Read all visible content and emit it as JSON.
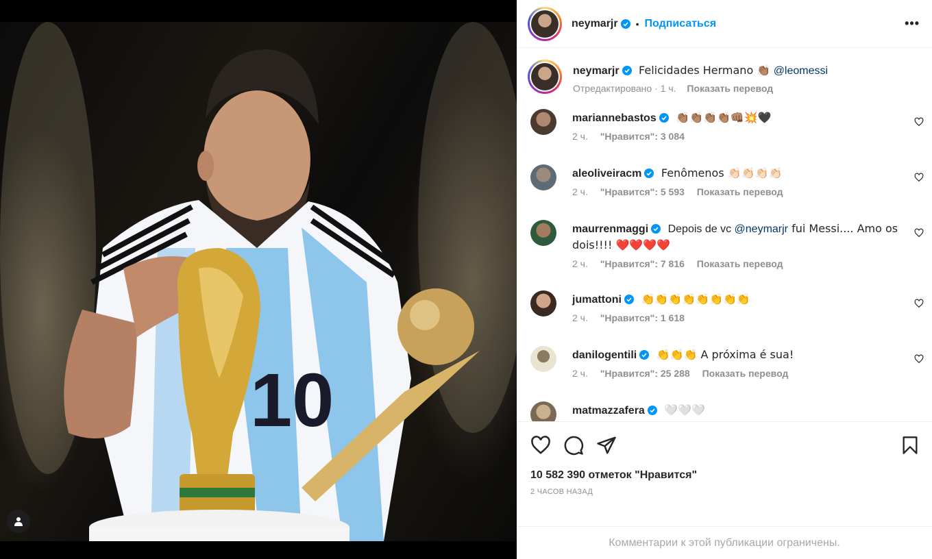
{
  "post": {
    "username": "neymarjr",
    "follow_label": "Подписаться",
    "more_label": "•••"
  },
  "caption": {
    "username": "neymarjr",
    "text": "Felicidades Hermano 👏🏽",
    "mention": "@leomessi",
    "edited_label": "Отредактировано",
    "time": "1 ч.",
    "translate_label": "Показать перевод"
  },
  "comments": [
    {
      "username": "mariannebastos",
      "text": "👏🏽👏🏽👏🏽👏🏽👊🏽💥🖤",
      "time": "2 ч.",
      "likes": "\"Нравится\": 3 084",
      "translate": ""
    },
    {
      "username": "aleoliveiracm",
      "text": "Fenômenos 👏🏻👏🏻👏🏻👏🏻",
      "time": "2 ч.",
      "likes": "\"Нравится\": 5 593",
      "translate": "Показать перевод"
    },
    {
      "username": "maurrenmaggi",
      "text_before": "Depois de vc ",
      "mention": "@neymarjr",
      "text_after": " fui Messi.... Amo os dois!!!! ❤️❤️❤️❤️",
      "time": "2 ч.",
      "likes": "\"Нравится\": 7 816",
      "translate": "Показать перевод"
    },
    {
      "username": "jumattoni",
      "text": "👏👏👏👏👏👏👏👏",
      "time": "2 ч.",
      "likes": "\"Нравится\": 1 618",
      "translate": ""
    },
    {
      "username": "danilogentili",
      "text": "👏👏👏 A próxima é sua!",
      "time": "2 ч.",
      "likes": "\"Нравится\": 25 288",
      "translate": "Показать перевод"
    },
    {
      "username": "matmazzafera",
      "text": "🤍🤍🤍",
      "time": "",
      "likes": "",
      "translate": ""
    }
  ],
  "likes_label": "10 582 390 отметок \"Нравится\"",
  "time_ago": "2 часов назад",
  "comments_limited": "Комментарии к этой публикации ограничены.",
  "icons": {
    "like": "heart-icon",
    "comment": "comment-icon",
    "share": "share-icon",
    "save": "bookmark-icon",
    "verified": "verified-badge-icon",
    "user_tag": "user-tag-icon"
  },
  "colors": {
    "follow": "#0095f6",
    "verified": "#0095f6",
    "mention": "#00376b",
    "secondary": "#8e8e8e"
  }
}
